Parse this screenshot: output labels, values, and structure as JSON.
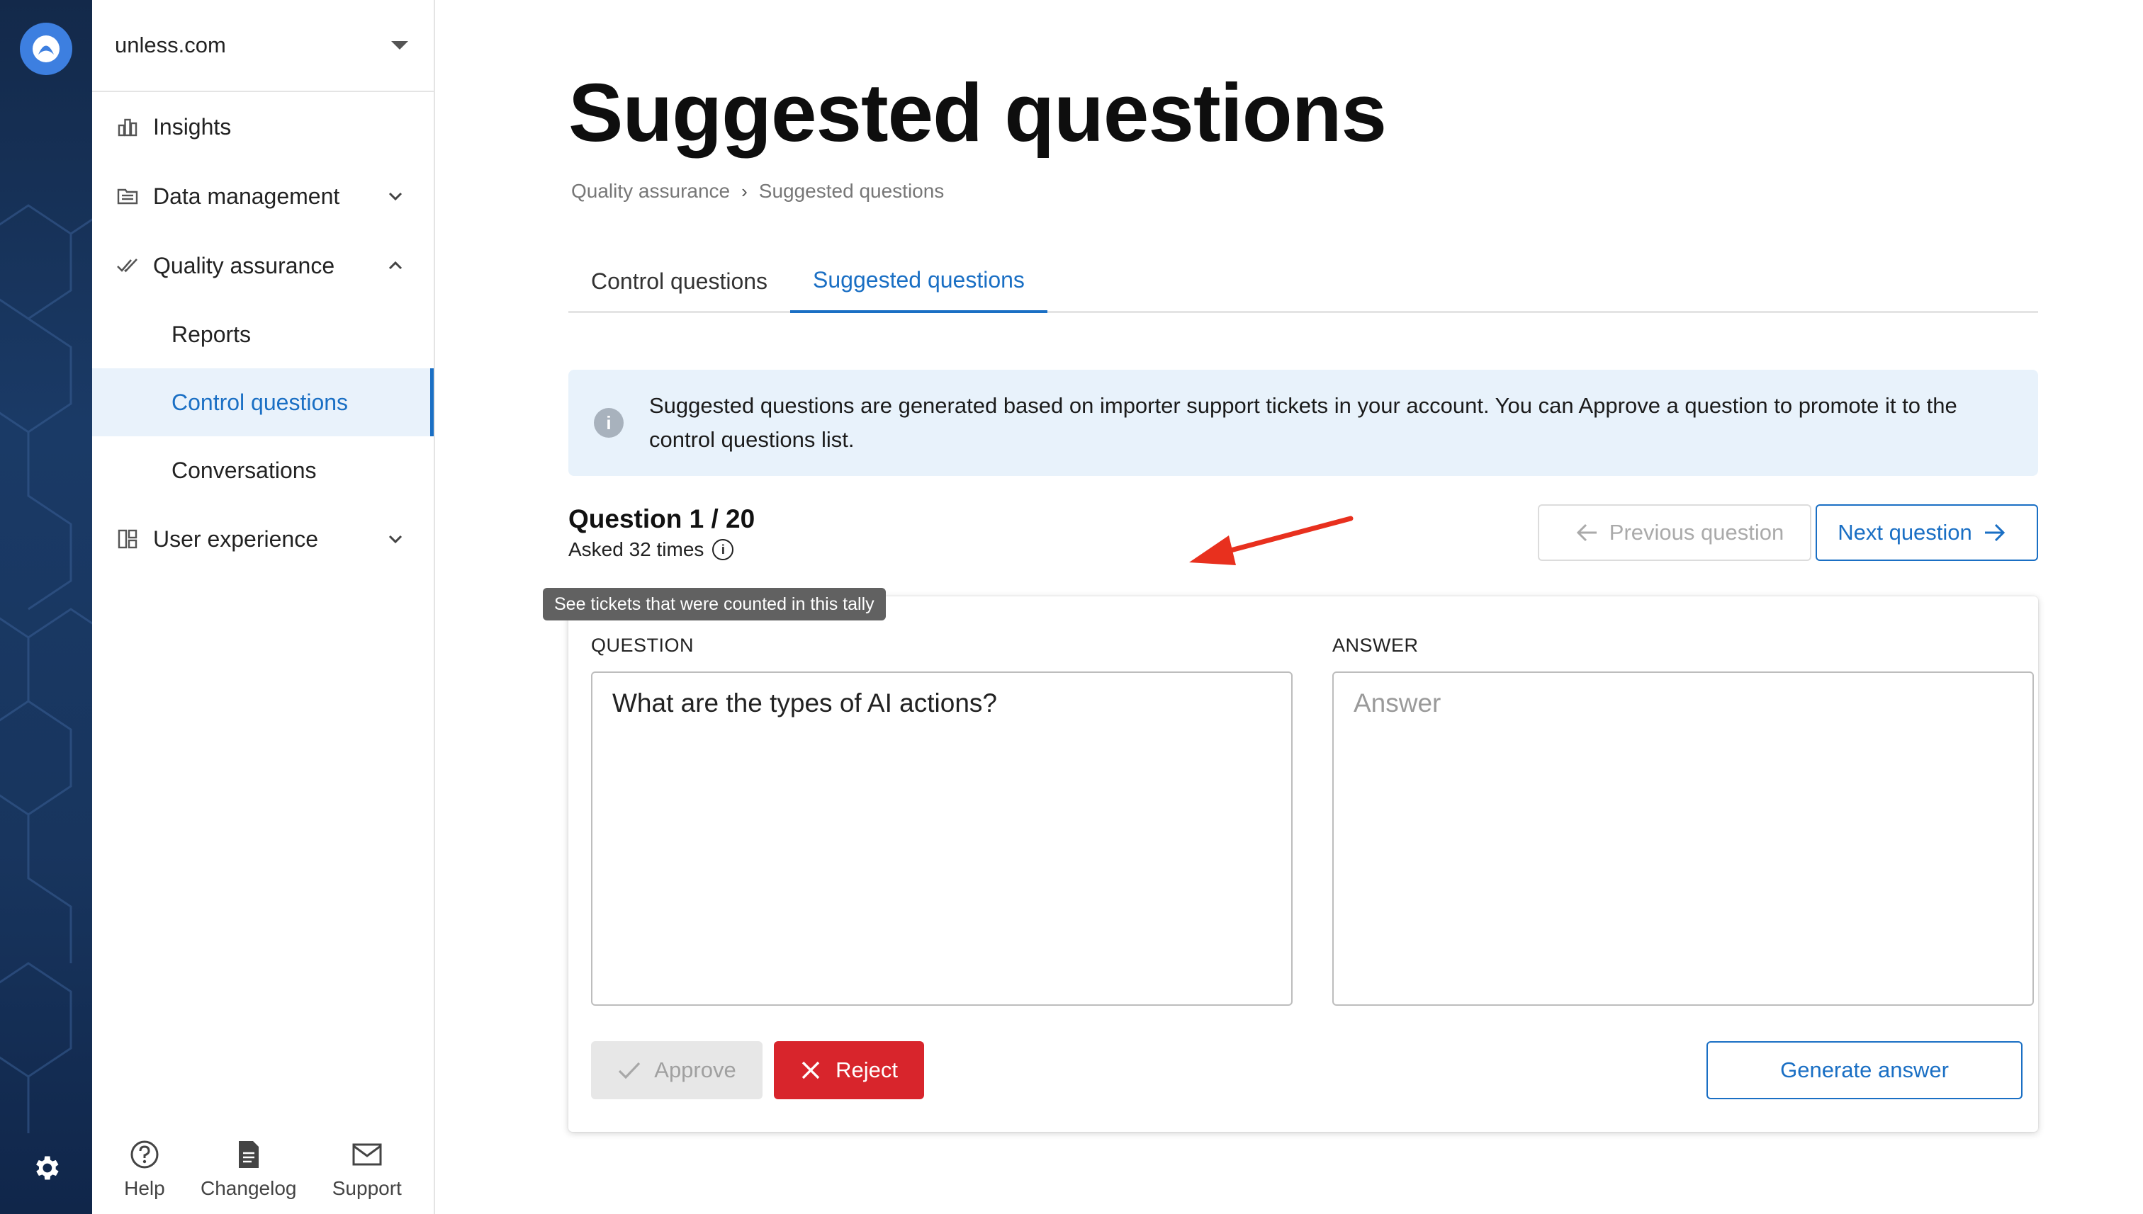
{
  "workspace": {
    "name": "unless.com"
  },
  "sidebar": {
    "items": [
      {
        "label": "Insights"
      },
      {
        "label": "Data management"
      },
      {
        "label": "Quality assurance"
      },
      {
        "label": "User experience"
      }
    ],
    "qa_sub": [
      {
        "label": "Reports"
      },
      {
        "label": "Control questions"
      },
      {
        "label": "Conversations"
      }
    ],
    "bottom": [
      {
        "label": "Help"
      },
      {
        "label": "Changelog"
      },
      {
        "label": "Support"
      }
    ]
  },
  "page": {
    "title": "Suggested questions",
    "breadcrumb": [
      "Quality assurance",
      "Suggested questions"
    ],
    "tabs": [
      {
        "label": "Control questions",
        "active": false
      },
      {
        "label": "Suggested questions",
        "active": true
      }
    ],
    "info": "Suggested questions are generated based on importer support tickets in your account. You can Approve a question to promote it to the control questions list."
  },
  "question": {
    "counter": "Question 1 / 20",
    "asked": "Asked 32 times",
    "tooltip": "See tickets that were counted in this tally",
    "prev_label": "Previous question",
    "next_label": "Next question",
    "question_label": "QUESTION",
    "answer_label": "ANSWER",
    "question_text": "What are the types of AI actions?",
    "answer_placeholder": "Answer",
    "approve_label": "Approve",
    "reject_label": "Reject",
    "generate_label": "Generate answer"
  },
  "colors": {
    "accent": "#1a6fc4",
    "danger": "#d8252c",
    "rail": "#1a3a66",
    "annotation": "#e8301e"
  }
}
